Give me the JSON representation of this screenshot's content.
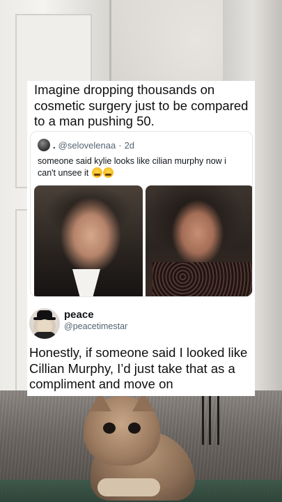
{
  "post": {
    "headline": "Imagine dropping thousands on cosmetic surgery just to be compared to a man pushing 50."
  },
  "tweet": {
    "dot": ".",
    "handle": "@selovelenaa",
    "separator": "·",
    "age": "2d",
    "text": "someone said kylie looks like cilian murphy now i can't unsee it",
    "emojis": [
      "crying-laughing-emoji",
      "crying-laughing-emoji"
    ]
  },
  "quote": {
    "name": "peace",
    "handle": "@peacetimestar",
    "text": "Honestly, if someone said I looked like Cillian Murphy, I’d just take that as a compliment and move on"
  },
  "colors": {
    "card_bg": "#ffffff",
    "text_primary": "#0f1419",
    "text_secondary": "#536471",
    "tweet_border": "#e3e5e8"
  }
}
